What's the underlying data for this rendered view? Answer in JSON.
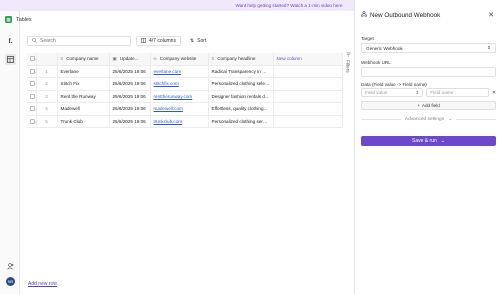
{
  "banner": {
    "text": "Want help getting started? Watch a 1-min video here"
  },
  "sidebar": {
    "logo": "f.",
    "avatar": "NR"
  },
  "header": {
    "title": "Tables"
  },
  "toolbar": {
    "search_placeholder": "Search",
    "columns_label": "4/7 columns",
    "sort_label": "Sort"
  },
  "filters": {
    "label": "Filters"
  },
  "table": {
    "columns": [
      "Company name",
      "Update...",
      "Company website",
      "Company headline"
    ],
    "new_column": "New column",
    "rows": [
      {
        "n": "1",
        "name": "Everlane",
        "updated": "25/6/2025 19:06",
        "website": "everlane.com",
        "headline": "Radical Transparency in Eth..."
      },
      {
        "n": "2",
        "name": "Stitch Fix",
        "updated": "25/6/2025 19:06",
        "website": "stitchfix.com",
        "headline": "Personalized clothing select..."
      },
      {
        "n": "3",
        "name": "Rent the Runway",
        "updated": "25/6/2025 19:06",
        "website": "renttherunway.com",
        "headline": "Designer fashion rentals deli..."
      },
      {
        "n": "4",
        "name": "Madewell",
        "updated": "25/6/2025 19:06",
        "website": "madewell.com",
        "headline": "Effortless, quality clothing..."
      },
      {
        "n": "5",
        "name": "Trunk Club",
        "updated": "25/6/2025 19:06",
        "website": "trunkclub.com",
        "headline": "Personalized clothing servic..."
      }
    ]
  },
  "footer": {
    "add_row": "Add new row"
  },
  "panel": {
    "title": "New Outbound Webhook",
    "target_label": "Target",
    "target_value": "Generic Webhook",
    "url_label": "Webhook URL",
    "data_label": "Data (Field value -> Field name)",
    "field_value_placeholder": "Field value",
    "field_name_placeholder": "Field name",
    "add_field": "Add field",
    "advanced": "Advanced settings",
    "run": "Save & run"
  },
  "colors": {
    "accent": "#6b48cc",
    "banner_bg": "#efe9fb",
    "link": "#2b5bd6"
  }
}
